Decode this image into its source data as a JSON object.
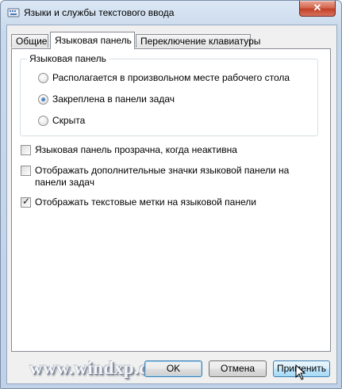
{
  "window": {
    "title": "Языки и службы текстового ввода",
    "close_glyph": "✕"
  },
  "tabs": [
    {
      "label": "Общие"
    },
    {
      "label": "Языковая панель"
    },
    {
      "label": "Переключение клавиатуры"
    }
  ],
  "language_bar": {
    "group_label": "Языковая панель",
    "options": [
      {
        "label": "Располагается в произвольном месте рабочего стола",
        "selected": false
      },
      {
        "label": "Закреплена в панели задач",
        "selected": true
      },
      {
        "label": "Скрыта",
        "selected": false
      }
    ]
  },
  "checkboxes": [
    {
      "label": "Языковая панель прозрачна, когда неактивна",
      "checked": false
    },
    {
      "label_line1": "Отображать дополнительные значки языковой панели на",
      "label_line2": "панели задач",
      "checked": false
    },
    {
      "label": "Отображать текстовые метки на языковой панели",
      "checked": true,
      "mark": "✓"
    }
  ],
  "watermark": "www.windxp.com.ru",
  "buttons": {
    "ok": "OK",
    "cancel": "Отмена",
    "apply": "Применить"
  }
}
